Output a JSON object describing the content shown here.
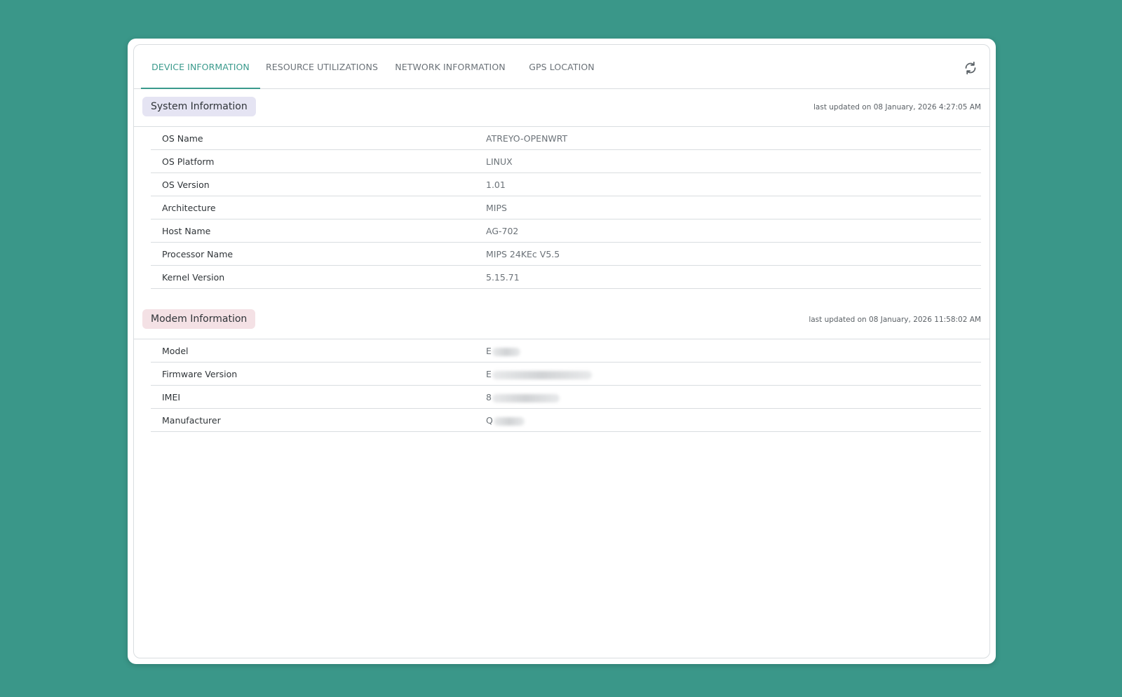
{
  "tabs": [
    {
      "label": "DEVICE INFORMATION",
      "active": true
    },
    {
      "label": "RESOURCE UTILIZATIONS",
      "active": false
    },
    {
      "label": "NETWORK INFORMATION",
      "active": false
    },
    {
      "label": "GPS LOCATION",
      "active": false
    }
  ],
  "refresh_icon": "refresh-icon",
  "colors": {
    "background": "#3a9789",
    "accent": "#3a9a8c",
    "system_pill": "#e5e4f3",
    "modem_pill": "#f4e1e5"
  },
  "system": {
    "title": "System Information",
    "updated": "last updated on 08 January, 2026 4:27:05 AM",
    "rows": [
      {
        "key": "OS Name",
        "value": "ATREYO-OPENWRT"
      },
      {
        "key": "OS Platform",
        "value": "LINUX"
      },
      {
        "key": "OS Version",
        "value": "1.01"
      },
      {
        "key": "Architecture",
        "value": "MIPS"
      },
      {
        "key": "Host Name",
        "value": "AG-702"
      },
      {
        "key": "Processor Name",
        "value": "MIPS 24KEc V5.5"
      },
      {
        "key": "Kernel Version",
        "value": "5.15.71"
      }
    ]
  },
  "modem": {
    "title": "Modem Information",
    "updated": "last updated on 08 January, 2026 11:58:02 AM",
    "rows": [
      {
        "key": "Model",
        "value": "E"
      },
      {
        "key": "Firmware Version",
        "value": "E"
      },
      {
        "key": "IMEI",
        "value": "8"
      },
      {
        "key": "Manufacturer",
        "value": "Q"
      }
    ]
  }
}
